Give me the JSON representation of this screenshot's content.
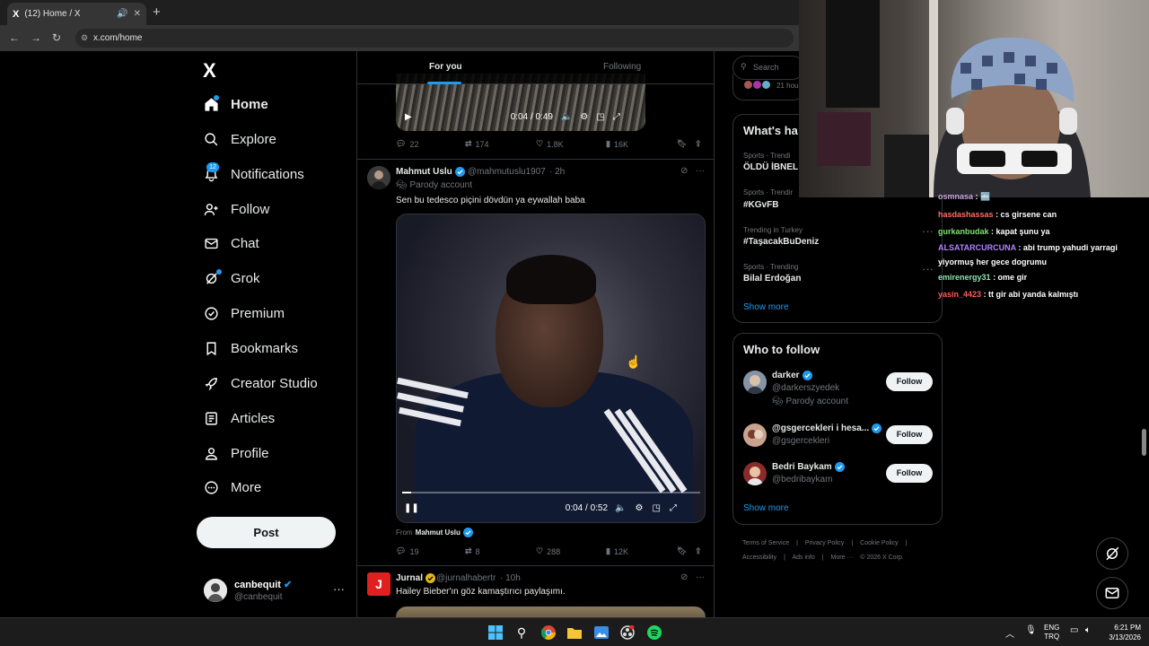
{
  "browser": {
    "tab_title": "(12) Home / X",
    "tab_favicon": "X",
    "url": "x.com/home"
  },
  "nav": {
    "logo": "X",
    "items": [
      {
        "label": "Home",
        "icon": "home-icon",
        "badge": ""
      },
      {
        "label": "Explore",
        "icon": "search-icon",
        "badge": ""
      },
      {
        "label": "Notifications",
        "icon": "bell-icon",
        "badge": "12"
      },
      {
        "label": "Follow",
        "icon": "person-add-icon",
        "badge": ""
      },
      {
        "label": "Chat",
        "icon": "envelope-icon",
        "badge": ""
      },
      {
        "label": "Grok",
        "icon": "grok-icon",
        "badge": ""
      },
      {
        "label": "Premium",
        "icon": "premium-icon",
        "badge": ""
      },
      {
        "label": "Bookmarks",
        "icon": "bookmark-icon",
        "badge": ""
      },
      {
        "label": "Creator Studio",
        "icon": "rocket-icon",
        "badge": ""
      },
      {
        "label": "Articles",
        "icon": "article-icon",
        "badge": ""
      },
      {
        "label": "Profile",
        "icon": "person-icon",
        "badge": ""
      },
      {
        "label": "More",
        "icon": "more-circle-icon",
        "badge": ""
      }
    ],
    "post_button": "Post",
    "account": {
      "name": "canbequit",
      "handle": "@canbequit"
    }
  },
  "timeline": {
    "tabs": [
      "For you",
      "Following"
    ],
    "post1": {
      "video_time": "0:04 / 0:49",
      "replies": "22",
      "reposts": "174",
      "likes": "1.8K",
      "views": "16K"
    },
    "post2": {
      "name": "Mahmut Uslu",
      "handle": "@mahmutuslu1907",
      "time": "· 2h",
      "parody": "Parody account",
      "text": "Sen bu tedesco piçini dövdün ya eywallah baba",
      "video_time": "0:04 / 0:52",
      "video_progress": 0.03,
      "from_label": "From",
      "from_name": "Mahmut Uslu",
      "replies": "19",
      "reposts": "8",
      "likes": "288",
      "views": "12K"
    },
    "post3": {
      "name": "Jurnal",
      "handle": "@jurnalhabertr",
      "time": "· 10h",
      "text": "Hailey Bieber'ın göz kamaştırıcı paylaşımı.",
      "avatar_letter": "J"
    }
  },
  "sidebar": {
    "search_placeholder": "Search",
    "live_time": "21 hou",
    "trends_title": "What's ha",
    "trends": [
      {
        "category": "Sports · Trendi",
        "title": "ÖLDÜ İBNEL"
      },
      {
        "category": "Sports · Trendir",
        "title": "#KGvFB"
      },
      {
        "category": "Trending in Turkey",
        "title": "#TaşacakBuDeniz"
      },
      {
        "category": "Sports · Trending",
        "title": "Bilal Erdoğan"
      }
    ],
    "trends_show_more": "Show more",
    "who_to_follow_title": "Who to follow",
    "who_to_follow": [
      {
        "name": "darker",
        "handle": "@darkerszyedek",
        "sub": "Parody account",
        "button": "Follow"
      },
      {
        "name": "@gsgercekleri i hesa...",
        "handle": "@gsgercekleri",
        "sub": "",
        "button": "Follow"
      },
      {
        "name": "Bedri Baykam",
        "handle": "@bedribaykam",
        "sub": "",
        "button": "Follow"
      }
    ],
    "wtf_show_more": "Show more",
    "footer": [
      "Terms of Service",
      "|",
      "Privacy Policy",
      "|",
      "Cookie Policy",
      "|",
      "Accessibility",
      "|",
      "Ads info",
      "|",
      "More ···",
      "© 2026 X Corp."
    ]
  },
  "chat": [
    {
      "user": "osmnasa",
      "text": ": 🔤",
      "color": "#c8a2e0"
    },
    {
      "user": "hasdashassas",
      "text": ": cs girsene can",
      "color": "#ff6b6b"
    },
    {
      "user": "gurkanbudak",
      "text": ": kapat şunu ya",
      "color": "#7ee36e"
    },
    {
      "user": "ALSATARCURCUNA",
      "text": ": abi trump yahudi yarragi",
      "color": "#b084ff"
    },
    {
      "user": "",
      "text": "yiyormuş her gece dogrumu",
      "color": "#ffffff"
    },
    {
      "user": "emirenergy31",
      "text": ": ome gir",
      "color": "#8fe3b5"
    },
    {
      "user": "yasin_4423",
      "text": ": tt gir abi yanda kalmıştı",
      "color": "#ff5a5a"
    }
  ],
  "taskbar": {
    "lang_top": "ENG",
    "lang_bottom": "TRQ",
    "time": "6:21 PM",
    "date": "3/13/2026"
  },
  "colors": {
    "accent": "#1d9bf0",
    "background": "#000000",
    "border": "#2f3336",
    "muted": "#71767b"
  }
}
